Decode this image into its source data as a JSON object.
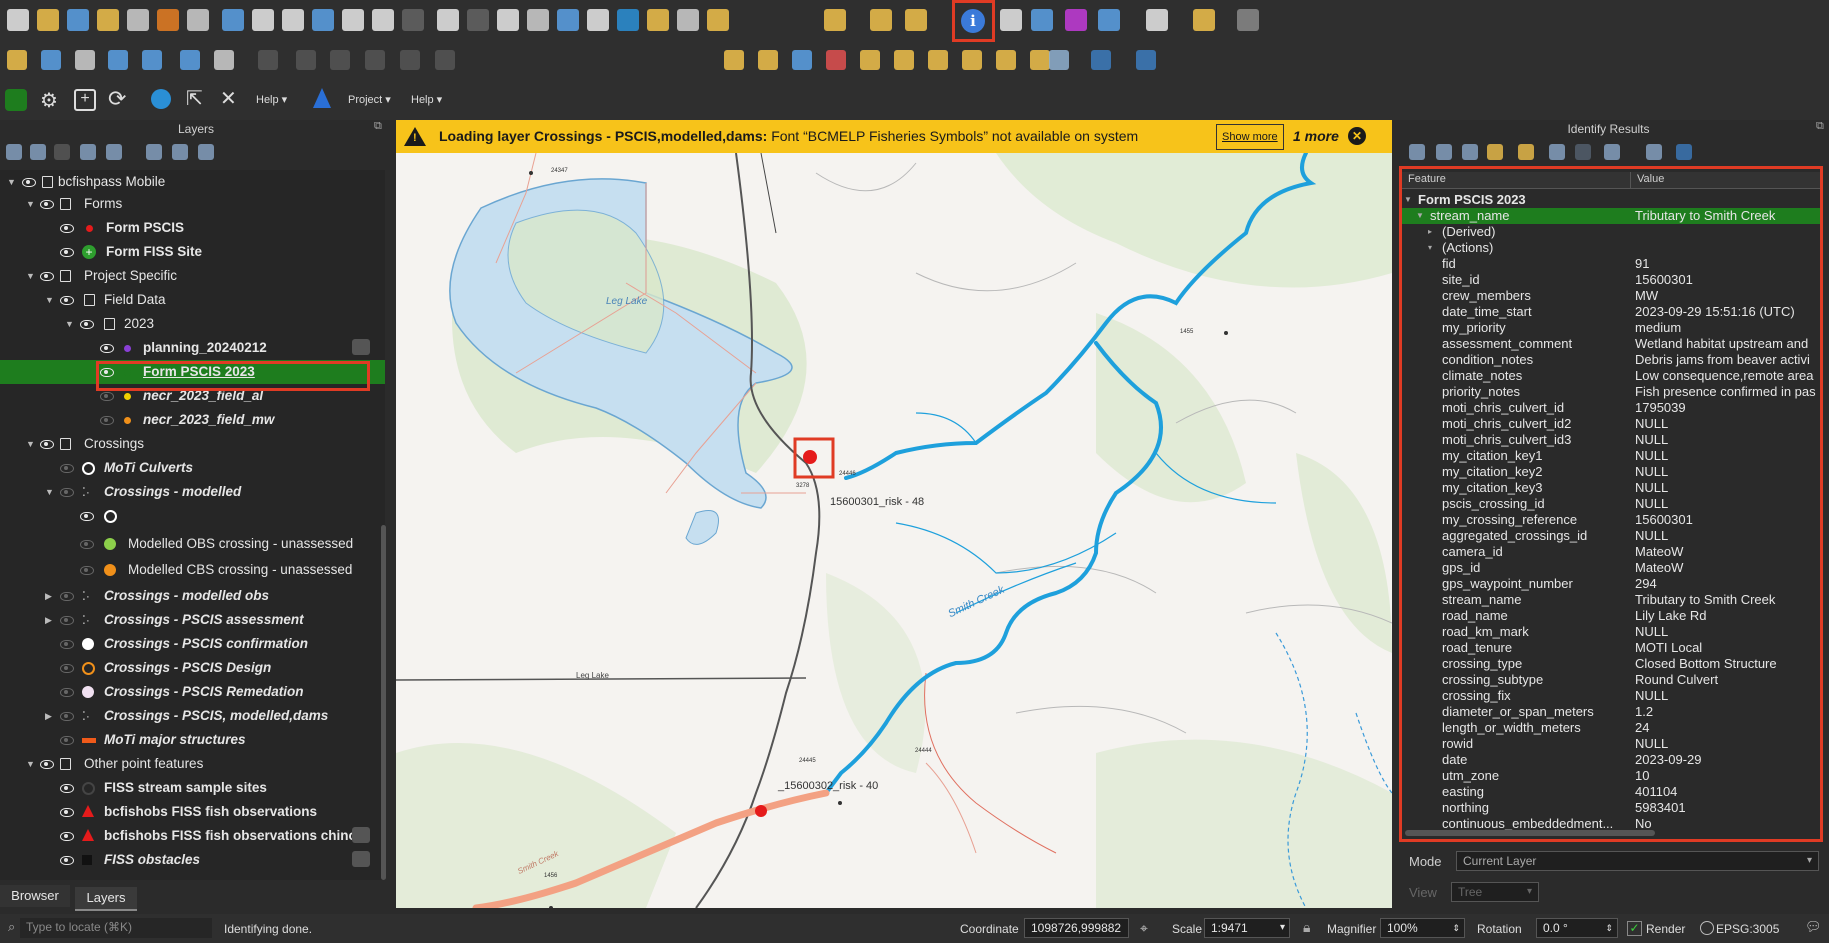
{
  "toolbar": {
    "help_label_1": "Help",
    "project_label": "Project",
    "help_label_2": "Help"
  },
  "layers_panel": {
    "title": "Layers",
    "tree": [
      {
        "label": "bcfishpass Mobile"
      },
      {
        "label": "Forms"
      },
      {
        "label": "Form PSCIS"
      },
      {
        "label": "Form FISS Site"
      },
      {
        "label": "Project Specific"
      },
      {
        "label": "Field Data"
      },
      {
        "label": "2023"
      },
      {
        "label": "planning_20240212"
      },
      {
        "label": "Form PSCIS 2023"
      },
      {
        "label": "necr_2023_field_al"
      },
      {
        "label": "necr_2023_field_mw"
      },
      {
        "label": "Crossings"
      },
      {
        "label": "MoTi Culverts"
      },
      {
        "label": "Crossings - modelled"
      },
      {
        "label": ""
      },
      {
        "label": "Modelled OBS crossing - unassessed"
      },
      {
        "label": "Modelled CBS crossing - unassessed"
      },
      {
        "label": "Crossings - modelled obs"
      },
      {
        "label": "Crossings - PSCIS assessment"
      },
      {
        "label": "Crossings - PSCIS confirmation"
      },
      {
        "label": "Crossings - PSCIS Design"
      },
      {
        "label": "Crossings - PSCIS Remedation"
      },
      {
        "label": "Crossings - PSCIS, modelled,dams"
      },
      {
        "label": "MoTi major structures"
      },
      {
        "label": "Other point features"
      },
      {
        "label": "FISS stream sample sites"
      },
      {
        "label": "bcfishobs FISS fish observations"
      },
      {
        "label": "bcfishobs FISS fish observations chino"
      },
      {
        "label": "FISS obstacles"
      }
    ],
    "tabs": [
      "Browser",
      "Layers"
    ]
  },
  "banner": {
    "bold_text": "Loading layer Crossings - PSCIS,modelled,dams:",
    "text": "Font “BCMELP Fisheries Symbols” not available on system",
    "show_more": "Show more",
    "more_count": "1 more"
  },
  "map_labels": {
    "lake": "Leg Lake",
    "road": "Leg Lake",
    "creek": "Smith Creek",
    "creek2": "Smith Creek",
    "risk1": "15600301_risk - 48",
    "risk2": "_15600302_risk - 40",
    "p1": "24347",
    "p2": "24446",
    "p3": "24444",
    "p4": "24445",
    "p5": "1455",
    "p6": "1456",
    "p7": "3278"
  },
  "identify": {
    "title": "Identify Results",
    "col_feature": "Feature",
    "col_value": "Value",
    "root": "Form PSCIS 2023",
    "highlight_field": "stream_name",
    "highlight_value": "Tributary to Smith Creek",
    "derived": "(Derived)",
    "actions": "(Actions)",
    "rows": [
      {
        "f": "fid",
        "v": "91"
      },
      {
        "f": "site_id",
        "v": "15600301"
      },
      {
        "f": "crew_members",
        "v": "MW"
      },
      {
        "f": "date_time_start",
        "v": "2023-09-29 15:51:16 (UTC)"
      },
      {
        "f": "my_priority",
        "v": "medium"
      },
      {
        "f": "assessment_comment",
        "v": "Wetland habitat upstream and"
      },
      {
        "f": "condition_notes",
        "v": "Debris jams from beaver activi"
      },
      {
        "f": "climate_notes",
        "v": "Low consequence,remote area"
      },
      {
        "f": "priority_notes",
        "v": "Fish presence confirmed in pas"
      },
      {
        "f": "moti_chris_culvert_id",
        "v": "1795039"
      },
      {
        "f": "moti_chris_culvert_id2",
        "v": "NULL"
      },
      {
        "f": "moti_chris_culvert_id3",
        "v": "NULL"
      },
      {
        "f": "my_citation_key1",
        "v": "NULL"
      },
      {
        "f": "my_citation_key2",
        "v": "NULL"
      },
      {
        "f": "my_citation_key3",
        "v": "NULL"
      },
      {
        "f": "pscis_crossing_id",
        "v": "NULL"
      },
      {
        "f": "my_crossing_reference",
        "v": "15600301"
      },
      {
        "f": "aggregated_crossings_id",
        "v": "NULL"
      },
      {
        "f": "camera_id",
        "v": "MateoW"
      },
      {
        "f": "gps_id",
        "v": "MateoW"
      },
      {
        "f": "gps_waypoint_number",
        "v": "294"
      },
      {
        "f": "stream_name",
        "v": "Tributary to Smith Creek"
      },
      {
        "f": "road_name",
        "v": "Lily Lake Rd"
      },
      {
        "f": "road_km_mark",
        "v": "NULL"
      },
      {
        "f": "road_tenure",
        "v": "MOTI Local"
      },
      {
        "f": "crossing_type",
        "v": "Closed Bottom Structure"
      },
      {
        "f": "crossing_subtype",
        "v": "Round Culvert"
      },
      {
        "f": "crossing_fix",
        "v": "NULL"
      },
      {
        "f": "diameter_or_span_meters",
        "v": "1.2"
      },
      {
        "f": "length_or_width_meters",
        "v": "24"
      },
      {
        "f": "rowid",
        "v": "NULL"
      },
      {
        "f": "date",
        "v": "2023-09-29"
      },
      {
        "f": "utm_zone",
        "v": "10"
      },
      {
        "f": "easting",
        "v": "401104"
      },
      {
        "f": "northing",
        "v": "5983401"
      },
      {
        "f": "continuous_embeddedment...",
        "v": "No"
      }
    ],
    "mode_label": "Mode",
    "mode_value": "Current Layer",
    "view_label": "View",
    "view_value": "Tree"
  },
  "statusbar": {
    "locator_placeholder": "Type to locate (⌘K)",
    "message": "Identifying done.",
    "coordinate_label": "Coordinate",
    "coordinate_value": "1098726,999882",
    "scale_label": "Scale",
    "scale_value": "1:9471",
    "magnifier_label": "Magnifier",
    "magnifier_value": "100%",
    "rotation_label": "Rotation",
    "rotation_value": "0.0 °",
    "render_label": "Render",
    "crs": "EPSG:3005"
  },
  "colors": {
    "accent_red": "#e03b24",
    "selected_green": "#1e7d1e",
    "banner_yellow": "#f7c31a",
    "stream_blue": "#1ea0dc"
  }
}
